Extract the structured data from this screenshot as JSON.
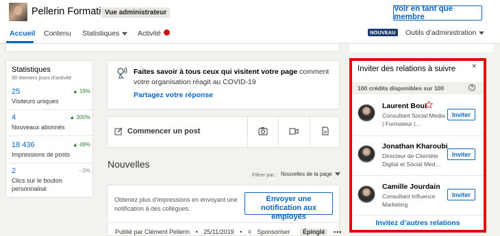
{
  "header": {
    "company_name": "Pellerin Formation",
    "admin_badge": "Vue administrateur",
    "view_as_member": "Voir en tant que membre"
  },
  "nav": {
    "tabs": [
      {
        "label": "Accueil",
        "active": true
      },
      {
        "label": "Contenu"
      },
      {
        "label": "Statistiques"
      },
      {
        "label": "Activité"
      }
    ],
    "new_badge": "NOUVEAU",
    "admin_tools": "Outils d’administration"
  },
  "stats": {
    "title": "Statistiques",
    "subtitle": "30 derniers jours d’activité",
    "items": [
      {
        "value": "25",
        "label": "Visiteurs uniques",
        "change": "▲ 19%"
      },
      {
        "value": "4",
        "label": "Nouveaux abonnés",
        "change": "▲ 300%"
      },
      {
        "value": "18 436",
        "label": "Impressions de posts",
        "change": "▲ 49%"
      },
      {
        "value": "2",
        "label": "Clics sur le bouton personnalisé",
        "change": "◦ 0%"
      }
    ]
  },
  "covid": {
    "text_bold": "Faites savoir à tous ceux qui visitent votre page",
    "text_rest": " comment votre organisation réagit au COVID-19",
    "link": "Partagez votre réponse"
  },
  "post": {
    "start_label": "Commencer un post"
  },
  "news": {
    "title": "Nouvelles",
    "filter_label": "Filtrer par :",
    "filter_value": "Nouvelles de la page"
  },
  "notify": {
    "text": "Obtenez plus d’impressions en envoyant une notification à des collègues.",
    "button": "Envoyer une notification aux employés",
    "published_by": "Publié par Clément Pellerin",
    "date": "25/11/2019",
    "sponsor": "Sponsoriser",
    "pinned": "Épinglé"
  },
  "invite": {
    "title": "Inviter des relations à suivre",
    "close": "×",
    "credits": "100 crédits disponibles sur 100",
    "help": "?",
    "people": [
      {
        "name": "Laurent Bour",
        "desc": "Consultant Social Media | Formateur |…",
        "button": "Inviter"
      },
      {
        "name": "Jonathan Kharoubi",
        "desc": "Directeur de Clientèle Digital et Social Med…",
        "button": "Inviter"
      },
      {
        "name": "Camille Jourdain",
        "desc": "Consultant Influence Marketing",
        "button": "Inviter"
      }
    ],
    "more_link": "Invitez d’autres relations"
  },
  "colors": {
    "accent": "#0a66c2",
    "highlight_frame": "#e0060c",
    "notification_dot": "#cc1016"
  }
}
